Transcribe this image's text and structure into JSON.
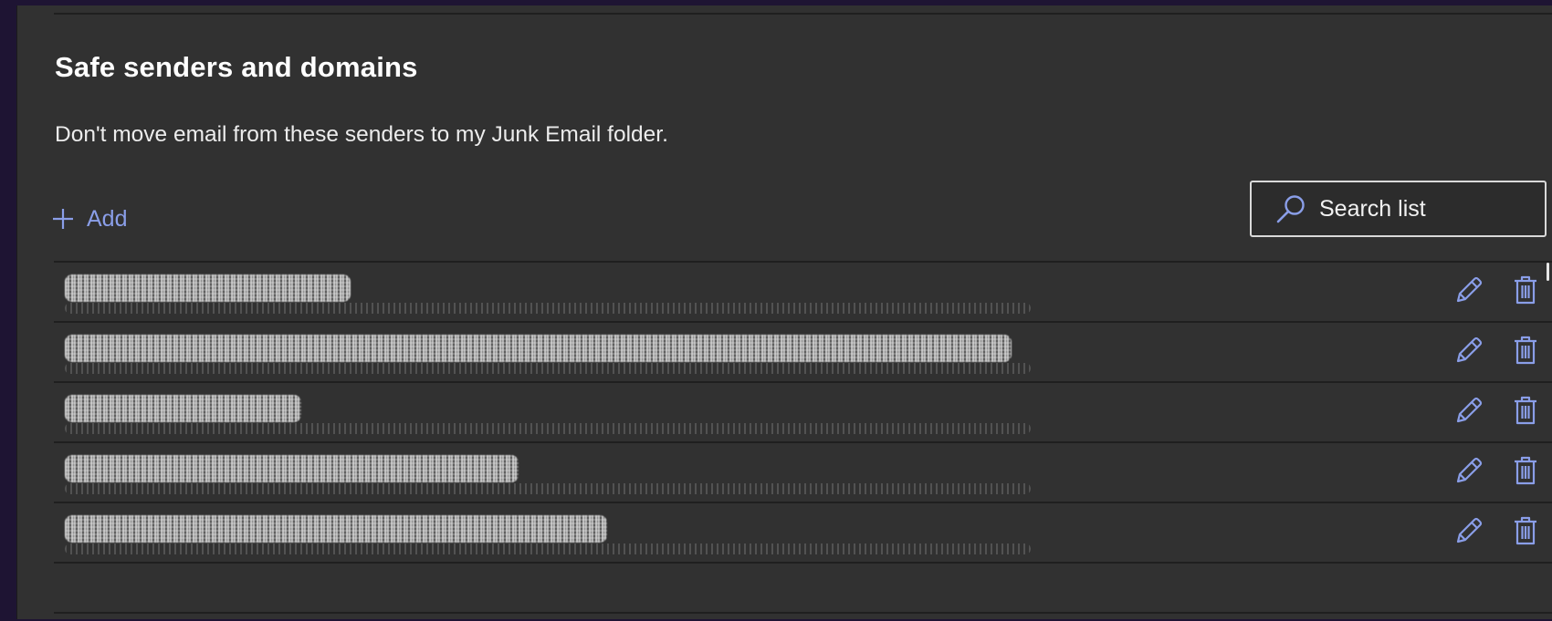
{
  "section": {
    "title": "Safe senders and domains",
    "description": "Don't move email from these senders to my Junk Email folder."
  },
  "toolbar": {
    "add_label": "Add",
    "search_placeholder": "Search list"
  },
  "list": {
    "rows": [
      {
        "redacted": true,
        "bar_width_fraction": 0.29
      },
      {
        "redacted": true,
        "bar_width_fraction": 0.96
      },
      {
        "redacted": true,
        "bar_width_fraction": 0.24
      },
      {
        "redacted": true,
        "bar_width_fraction": 0.46
      },
      {
        "redacted": true,
        "bar_width_fraction": 0.55
      }
    ]
  },
  "icons": {
    "add": "plus-icon",
    "search": "search-icon",
    "edit": "pencil-icon",
    "delete": "trash-icon"
  },
  "colors": {
    "accent": "#8a9ee8",
    "panel_background": "#313131",
    "outer_background": "#1e1433"
  }
}
